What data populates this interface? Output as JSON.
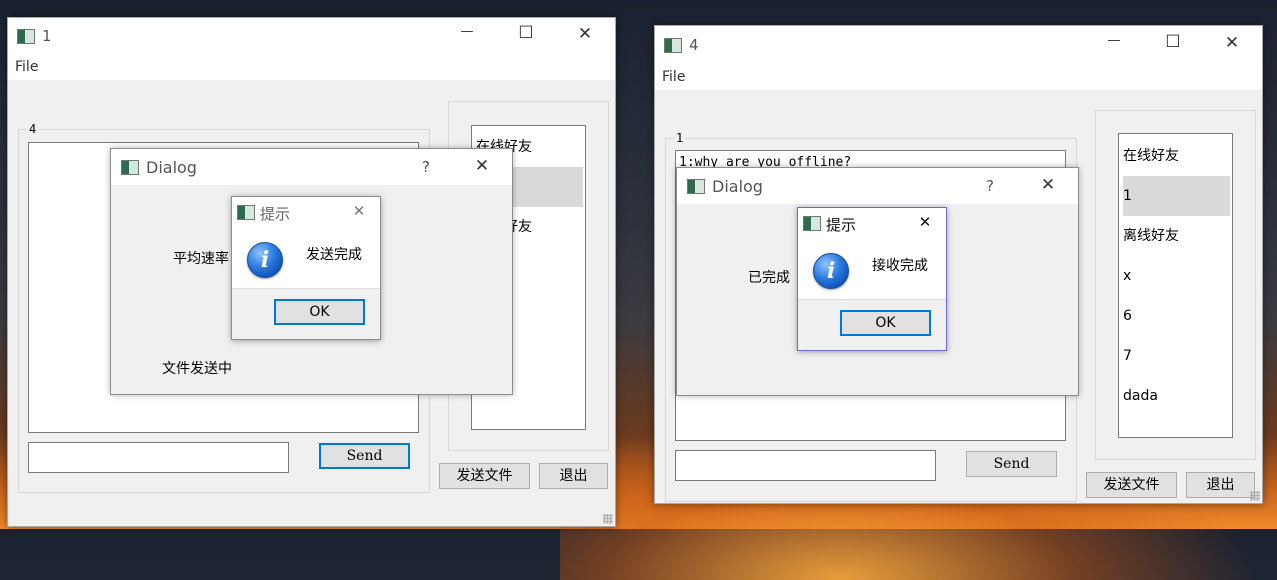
{
  "window1": {
    "title": "1",
    "menu_file": "File",
    "chat_group_title": "4",
    "send_label": "Send",
    "send_file_label": "发送文件",
    "exit_label": "退出",
    "friends": [
      "在线好友",
      "",
      "离线好友"
    ],
    "dialog": {
      "title": "Dialog",
      "help": "?",
      "rate_label": "平均速率",
      "status_label": "文件发送中"
    },
    "message": {
      "title": "提示",
      "text": "发送完成",
      "ok": "OK"
    }
  },
  "window2": {
    "title": "4",
    "menu_file": "File",
    "chat_group_title": "1",
    "chat_text": "1:why are you offline?",
    "send_label": "Send",
    "send_file_label": "发送文件",
    "exit_label": "退出",
    "friends": [
      "在线好友",
      "1",
      "离线好友",
      "x",
      "6",
      "7",
      "dada"
    ],
    "dialog": {
      "title": "Dialog",
      "help": "?",
      "status_label": "已完成"
    },
    "message": {
      "title": "提示",
      "text": "接收完成",
      "ok": "OK"
    }
  },
  "icons": {
    "minimize": "—",
    "maximize": "☐",
    "close": "✕",
    "info": "i"
  }
}
